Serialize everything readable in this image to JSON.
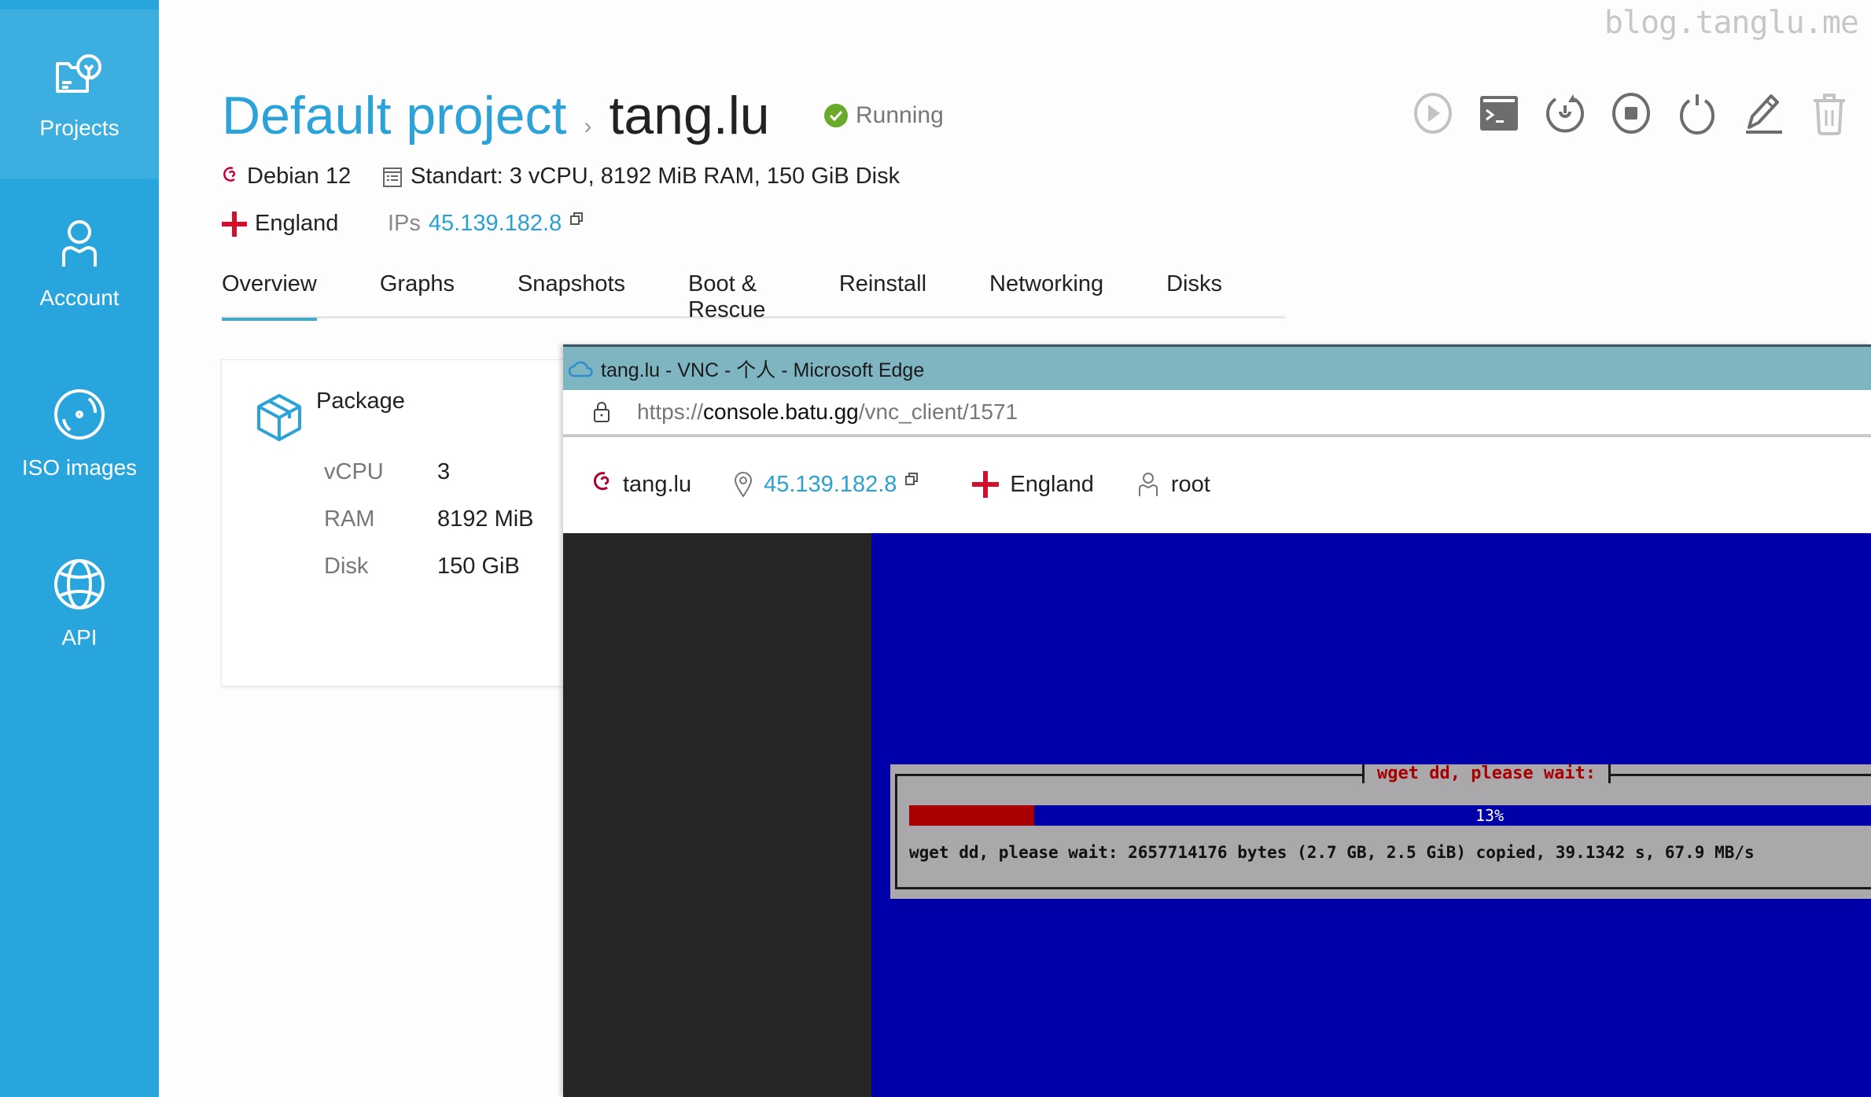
{
  "watermark": "blog.tanglu.me",
  "sidebar": {
    "items": [
      {
        "label": "Projects",
        "icon": "projects-icon",
        "active": true
      },
      {
        "label": "Account",
        "icon": "account-icon"
      },
      {
        "label": "ISO images",
        "icon": "iso-icon"
      },
      {
        "label": "API",
        "icon": "globe-icon"
      }
    ]
  },
  "header": {
    "project": "Default project",
    "separator": "›",
    "host": "tang.lu",
    "status": "Running"
  },
  "actions": [
    "start",
    "console",
    "reboot",
    "stop",
    "power-off",
    "rename",
    "delete"
  ],
  "meta": {
    "os": "Debian 12",
    "plan": "Standart: 3 vCPU, 8192 MiB RAM, 150 GiB Disk",
    "location": "England",
    "ips_label": "IPs",
    "ip": "45.139.182.8"
  },
  "tabs": [
    "Overview",
    "Graphs",
    "Snapshots",
    "Boot & Rescue",
    "Reinstall",
    "Networking",
    "Disks"
  ],
  "package": {
    "title": "Package",
    "specs": [
      {
        "key": "vCPU",
        "value": "3"
      },
      {
        "key": "RAM",
        "value": "8192 MiB"
      },
      {
        "key": "Disk",
        "value": "150 GiB"
      }
    ]
  },
  "vnc": {
    "window_title": "tang.lu - VNC - 个人 - Microsoft Edge",
    "url_scheme": "https://",
    "url_domain": "console.batu.gg",
    "url_path": "/vnc_client/1571",
    "host": "tang.lu",
    "ip": "45.139.182.8",
    "location": "England",
    "user": "root",
    "dialog_title": "wget dd, please wait:",
    "progress_percent": 13,
    "progress_label": "13%",
    "dialog_text": "wget dd, please wait: 2657714176 bytes (2.7 GB, 2.5 GiB) copied, 39.1342 s, 67.9 MB/s"
  }
}
